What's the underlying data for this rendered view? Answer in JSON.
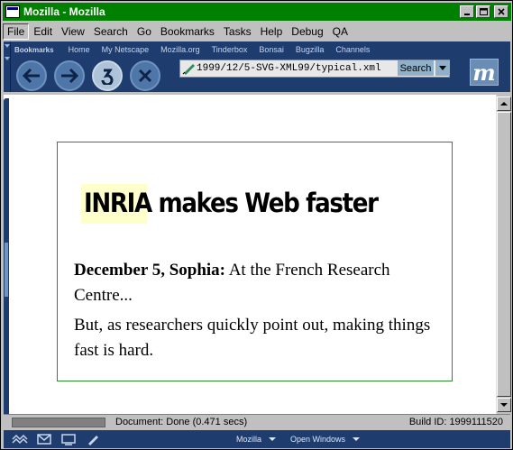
{
  "window": {
    "title": "Mozilla - Mozilla",
    "controls": [
      "minimize",
      "maximize",
      "close"
    ]
  },
  "menubar": {
    "items": [
      "File",
      "Edit",
      "View",
      "Search",
      "Go",
      "Bookmarks",
      "Tasks",
      "Help",
      "Debug",
      "QA"
    ]
  },
  "personal_toolbar": {
    "bookmarks_label": "Bookmarks",
    "links": [
      "Home",
      "My Netscape",
      "Mozilla.org",
      "Tinderbox",
      "Bonsai",
      "Bugzilla",
      "Channels"
    ]
  },
  "navigation": {
    "back_icon": "back-arrow-icon",
    "forward_icon": "forward-arrow-icon",
    "reload_icon": "reload-icon",
    "stop_icon": "stop-icon",
    "url": "1999/12/5-SVG-XML99/typical.xml",
    "search_label": "Search",
    "logo_letter": "m"
  },
  "document": {
    "headline_highlight": "INRIA",
    "headline_rest": " makes Web faster",
    "para1_bold": "December 5, Sophia:",
    "para1_text": " At the French Research Centre...",
    "para2_text": "But, as researchers quickly point out, making things fast is hard.",
    "border_color": "#2a8a2a",
    "highlight_color": "#ffffcc"
  },
  "status": {
    "text": "Document: Done (0.471 secs)",
    "build": "Build ID: 1999111520",
    "progress": 0
  },
  "taskbar": {
    "icons": [
      "navigator-icon",
      "mail-icon",
      "composer-icon",
      "edit-icon"
    ],
    "menus": [
      "Mozilla",
      "Open Windows"
    ]
  },
  "colors": {
    "titlebar": "#008000",
    "toolbar": "#1e3c6e",
    "chrome": "#c0c0c0"
  }
}
